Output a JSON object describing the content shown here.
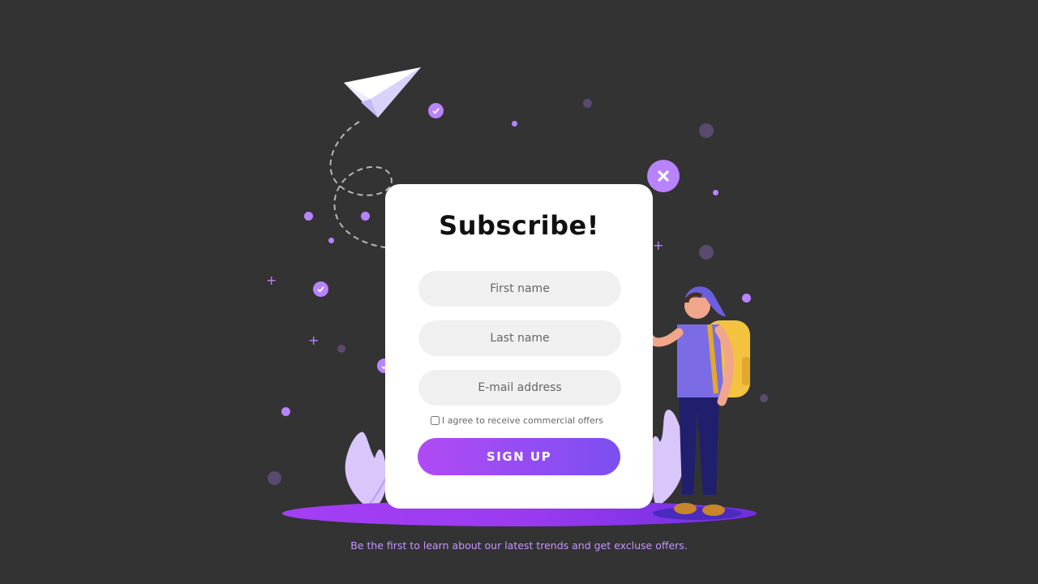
{
  "form": {
    "title": "Subscribe!",
    "fields": {
      "first_name_placeholder": "First name",
      "last_name_placeholder": "Last name",
      "email_placeholder": "E-mail address"
    },
    "consent_label": "I agree to receive commercial offers",
    "consent_checked": false,
    "submit_label": "SIGN UP"
  },
  "footer": {
    "tagline": "Be the first to learn about our latest trends and get excluse offers."
  },
  "icons": {
    "close": "close-icon",
    "paper_plane": "paper-plane-icon",
    "check": "check-icon"
  },
  "colors": {
    "background": "#333333",
    "accent": "#b983ff",
    "button_gradient_start": "#b14af5",
    "button_gradient_end": "#7b4ff0",
    "footer_text": "#c595ff"
  }
}
